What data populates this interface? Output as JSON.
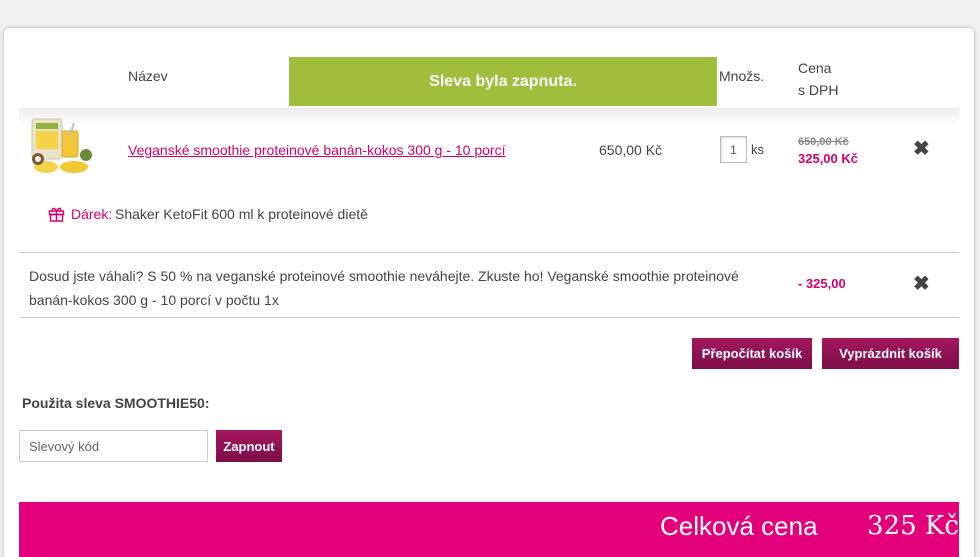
{
  "header": {
    "name_label": "Název",
    "qty_label": "Množs.",
    "price_label_line1": "Cena",
    "price_label_line2": "s DPH"
  },
  "toast": {
    "message": "Sleva byla zapnuta."
  },
  "cart": {
    "items": [
      {
        "image": "smoothie-package-image",
        "name": "Veganské smoothie proteinové banán-kokos 300 g - 10 porcí",
        "unit_price": "650,00 Kč",
        "quantity": "1",
        "unit": "ks",
        "old_price": "650,00 Kč",
        "new_price": "325,00 Kč",
        "remove_icon": "close-icon",
        "gift": {
          "icon": "gift-icon",
          "label": "Dárek:",
          "text": "Shaker KetoFit 600 ml k proteinové dietě"
        }
      }
    ],
    "discount_row": {
      "text": "Dosud jste váhali? S 50 % na veganské proteinové smoothie neváhejte. Zkuste ho! Veganské smoothie proteinové banán-kokos 300 g - 10 porcí v počtu 1x",
      "amount": "- 325,00",
      "remove_icon": "close-icon"
    }
  },
  "actions": {
    "recalc_label": "Přepočítat košík",
    "empty_label": "Vyprázdnit košík"
  },
  "coupon": {
    "title": "Použita sleva SMOOTHIE50:",
    "placeholder": "Slevový kód",
    "apply_label": "Zapnout"
  },
  "total": {
    "label": "Celková cena",
    "value": "325 Kč"
  },
  "colors": {
    "accent": "#e3007b",
    "link": "#d4006f",
    "button": "#8a1050",
    "toast": "#9fbe3c"
  }
}
